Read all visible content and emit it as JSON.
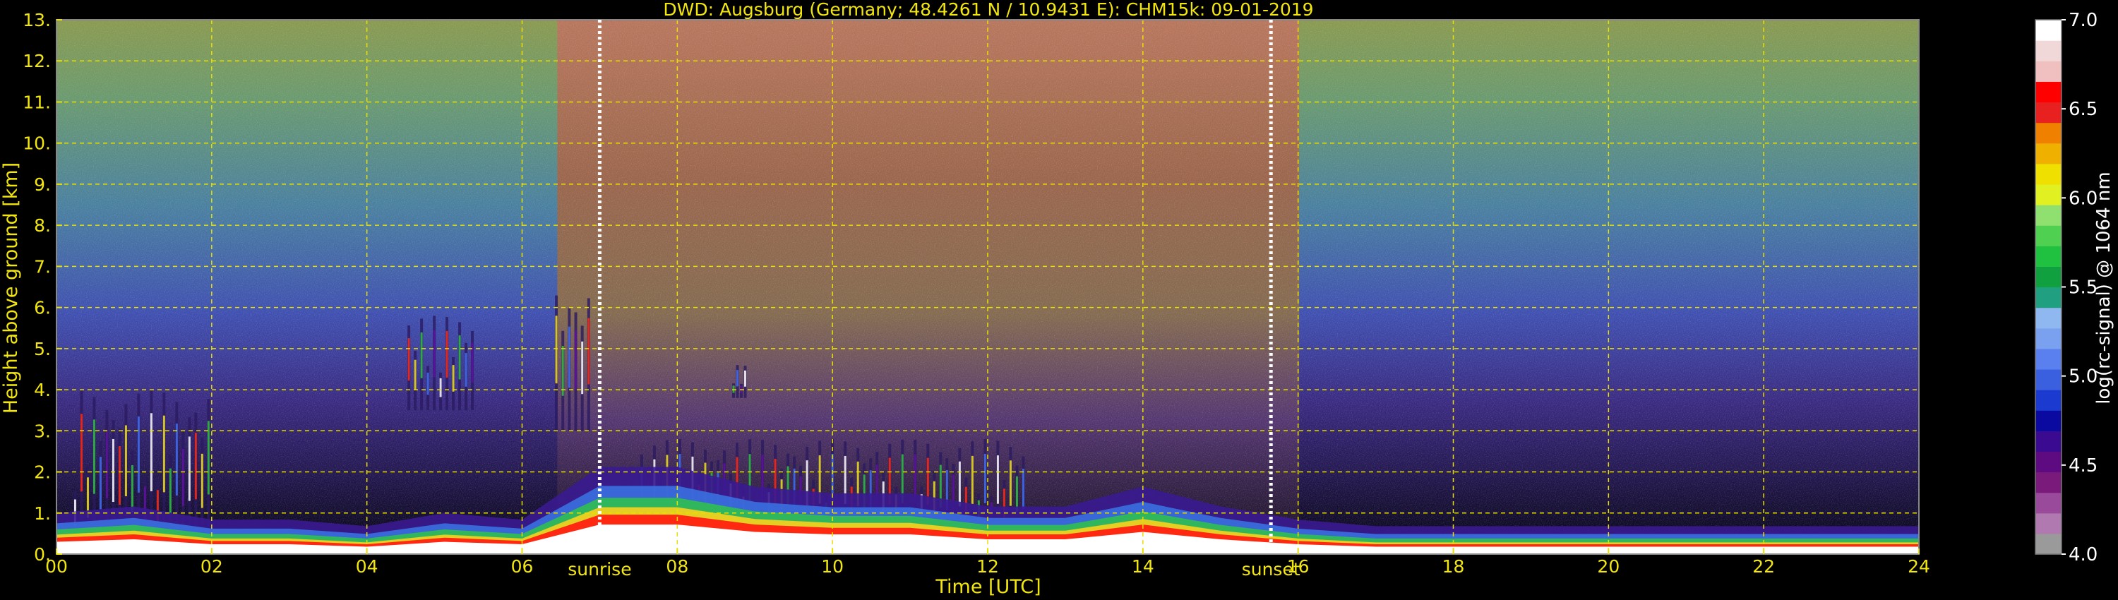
{
  "chart_data": {
    "type": "heatmap",
    "title": "DWD: Augsburg (Germany; 48.4261 N / 10.9431 E):    CHM15k: 09-01-2019",
    "xlabel": "Time [UTC]",
    "ylabel": "Height above ground [km]",
    "xlim": [
      0,
      24
    ],
    "ylim": [
      0,
      13
    ],
    "x_ticks": [
      0,
      2,
      4,
      6,
      8,
      10,
      12,
      14,
      16,
      18,
      20,
      22,
      24
    ],
    "x_tick_labels": [
      "00",
      "02",
      "04",
      "06",
      "08",
      "10",
      "12",
      "14",
      "16",
      "18",
      "20",
      "22",
      "24"
    ],
    "y_ticks": [
      0,
      1,
      2,
      3,
      4,
      5,
      6,
      7,
      8,
      9,
      10,
      11,
      12,
      13
    ],
    "y_tick_labels": [
      "0.",
      "1.",
      "2.",
      "3.",
      "4.",
      "5.",
      "6.",
      "7.",
      "8.",
      "9.",
      "10.",
      "11.",
      "12.",
      "13."
    ],
    "grid": true,
    "annotations": [
      {
        "text": "sunrise",
        "x": 7.0
      },
      {
        "text": "sunset",
        "x": 15.65
      }
    ],
    "colorbar": {
      "label": "log(rc-signal) @ 1064 nm",
      "range": [
        4.0,
        7.0
      ],
      "ticks": [
        4.0,
        4.5,
        5.0,
        5.5,
        6.0,
        6.5,
        7.0
      ],
      "tick_labels": [
        "4.0",
        "4.5",
        "5.0",
        "5.5",
        "6.0",
        "6.5",
        "7.0"
      ],
      "colors": [
        "#9a9a9a",
        "#b07ab0",
        "#9a4a9a",
        "#7a1a7a",
        "#5e0a80",
        "#3a0a90",
        "#0a0aa0",
        "#1a3ad0",
        "#3a60e0",
        "#5a80f0",
        "#7aa0f0",
        "#90b8f0",
        "#20a080",
        "#10a040",
        "#20c040",
        "#50d050",
        "#90e070",
        "#e0f020",
        "#f0e000",
        "#f0b000",
        "#f08000",
        "#e82020",
        "#ff0000",
        "#f0c0c0",
        "#f0d8d8",
        "#ffffff"
      ]
    },
    "signal_profile": {
      "hours": [
        0,
        1,
        2,
        3,
        4,
        5,
        6,
        7,
        8,
        9,
        10,
        11,
        12,
        13,
        14,
        15,
        16,
        17,
        18,
        19,
        20,
        21,
        22,
        23,
        24
      ],
      "boundary_layer_top_km": [
        0.5,
        0.6,
        0.4,
        0.4,
        0.3,
        0.5,
        0.4,
        1.2,
        1.2,
        0.9,
        0.8,
        0.8,
        0.6,
        0.6,
        0.9,
        0.6,
        0.4,
        0.3,
        0.3,
        0.3,
        0.3,
        0.3,
        0.3,
        0.3,
        0.3
      ],
      "cloud_layers": [
        {
          "x_start": 0.2,
          "x_end": 2.0,
          "base_km": 0.2,
          "top_km": 4.0
        },
        {
          "x_start": 4.5,
          "x_end": 5.4,
          "base_km": 3.5,
          "top_km": 5.8
        },
        {
          "x_start": 6.4,
          "x_end": 6.9,
          "base_km": 3.0,
          "top_km": 6.5
        },
        {
          "x_start": 8.7,
          "x_end": 8.9,
          "base_km": 3.8,
          "top_km": 4.6
        },
        {
          "x_start": 7.5,
          "x_end": 12.5,
          "base_km": 0.4,
          "top_km": 2.8
        }
      ],
      "daylight_noise": {
        "start": 7.0,
        "end": 15.65
      }
    }
  }
}
